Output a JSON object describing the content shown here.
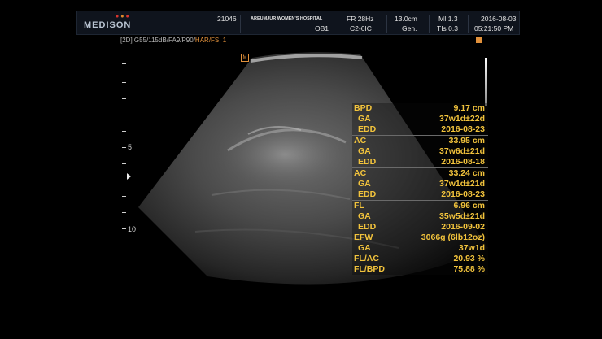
{
  "header": {
    "logo": "MEDISON",
    "patient_id": "21046",
    "hospital": "AREUMJUR WOMEN'S HOSPITAL",
    "exam": "OB1",
    "frame_rate": "FR 28Hz",
    "probe": "C2-6IC",
    "depth": "13.0cm",
    "preset": "Gen.",
    "mi": "MI 1.3",
    "tis": "TIs 0.3",
    "date": "2016-08-03",
    "time": "05:21:50 PM"
  },
  "mode_bar": {
    "mode": "[2D]",
    "params": "G55/115dB/FA9/P90/",
    "harmonic": "HAR/FSI 1"
  },
  "orientation_mark": "M",
  "depth_scale": {
    "labels": [
      "5",
      "10"
    ]
  },
  "measurements": [
    {
      "label": "BPD",
      "value": "9.17 cm",
      "sub": false,
      "top_line": false
    },
    {
      "label": "GA",
      "value": "37w1d±22d",
      "sub": true,
      "top_line": false
    },
    {
      "label": "EDD",
      "value": "2016-08-23",
      "sub": true,
      "top_line": false
    },
    {
      "label": "AC",
      "value": "33.95 cm",
      "sub": false,
      "top_line": true
    },
    {
      "label": "GA",
      "value": "37w6d±21d",
      "sub": true,
      "top_line": false
    },
    {
      "label": "EDD",
      "value": "2016-08-18",
      "sub": true,
      "top_line": false
    },
    {
      "label": "AC",
      "value": "33.24 cm",
      "sub": false,
      "top_line": true
    },
    {
      "label": "GA",
      "value": "37w1d±21d",
      "sub": true,
      "top_line": false
    },
    {
      "label": "EDD",
      "value": "2016-08-23",
      "sub": true,
      "top_line": false
    },
    {
      "label": "FL",
      "value": "6.96 cm",
      "sub": false,
      "top_line": true
    },
    {
      "label": "GA",
      "value": "35w5d±21d",
      "sub": true,
      "top_line": false
    },
    {
      "label": "EDD",
      "value": "2016-09-02",
      "sub": true,
      "top_line": false
    },
    {
      "label": "EFW",
      "value": "3066g (6lb12oz)",
      "sub": false,
      "top_line": false
    },
    {
      "label": "GA",
      "value": "37w1d",
      "sub": true,
      "top_line": false
    },
    {
      "label": "FL/AC",
      "value": "20.93 %",
      "sub": false,
      "top_line": false
    },
    {
      "label": "FL/BPD",
      "value": "75.88 %",
      "sub": false,
      "top_line": false
    }
  ]
}
